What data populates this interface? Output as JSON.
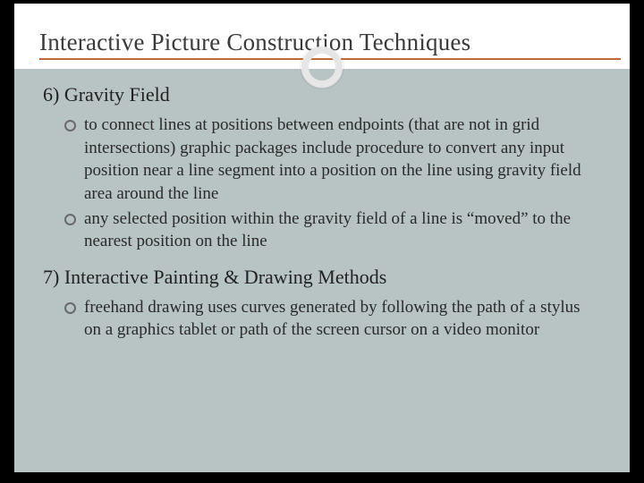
{
  "title": "Interactive Picture Construction Techniques",
  "sections": [
    {
      "heading": "6) Gravity Field",
      "items": [
        "to connect lines at positions between endpoints (that are not in grid intersections) graphic packages include procedure to convert any input position near a line segment into a position on the line using gravity field area around the line",
        "any selected position within the gravity field of a line is “moved” to the nearest position on the line"
      ]
    },
    {
      "heading": "7) Interactive Painting & Drawing Methods",
      "items": [
        "freehand drawing uses curves generated by following the path of a stylus on a graphics tablet or path of the screen cursor on a video monitor"
      ]
    }
  ]
}
